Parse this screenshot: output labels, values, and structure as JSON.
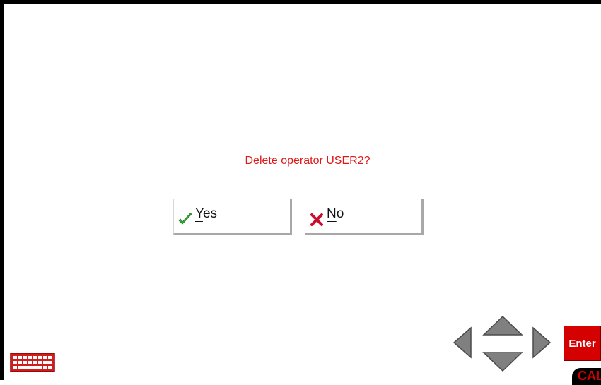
{
  "dialog": {
    "message": "Delete operator USER2?",
    "yes_mnemonic": "Y",
    "yes_rest": "es",
    "no_mnemonic": "N",
    "no_rest": "o"
  },
  "keypad": {
    "enter_label": "Enter",
    "cal_label": "CAL"
  },
  "icons": {
    "yes": "checkmark-icon",
    "no": "x-icon",
    "keyboard": "keyboard-icon",
    "nav": [
      "arrow-left-icon",
      "arrow-up-icon",
      "arrow-down-icon",
      "arrow-right-icon"
    ]
  },
  "colors": {
    "message": "#e01818",
    "check": "#33a833",
    "cross": "#c8102e",
    "enter_bg": "#d50000",
    "nav_gray": "#808080"
  }
}
